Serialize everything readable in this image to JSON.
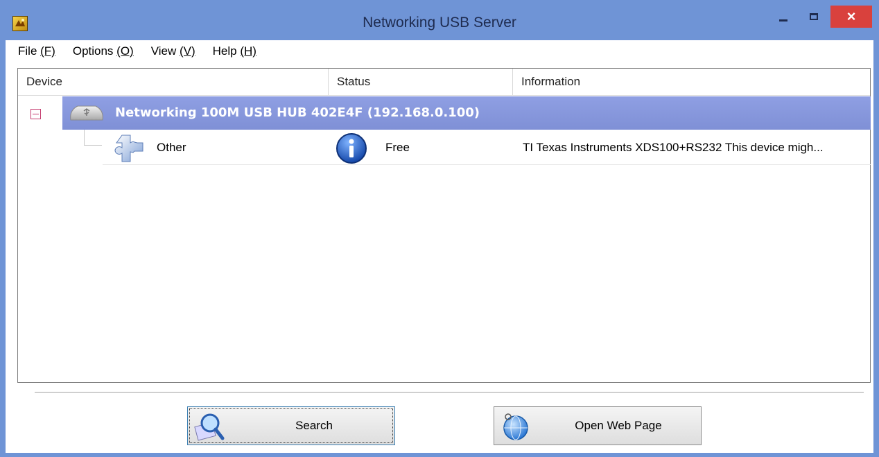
{
  "window": {
    "title": "Networking USB Server",
    "close_glyph": "×"
  },
  "menu": [
    {
      "label": "File ",
      "accel": "(F)"
    },
    {
      "label": "Options ",
      "accel": "(O)"
    },
    {
      "label": "View ",
      "accel": "(V)"
    },
    {
      "label": "Help ",
      "accel": "(H)"
    }
  ],
  "columns": {
    "device": "Device",
    "status": "Status",
    "information": "Information"
  },
  "hub": {
    "label": "Networking 100M USB HUB 402E4F  (192.168.0.100)",
    "icon": "usb-hub-icon",
    "expanded": true
  },
  "devices": [
    {
      "name": "Other",
      "icon": "puzzle-piece-icon",
      "status": "Free",
      "status_icon": "info-icon",
      "information": "TI Texas Instruments XDS100+RS232 This device migh..."
    }
  ],
  "buttons": {
    "search": "Search",
    "open_web_page": "Open Web Page"
  },
  "colors": {
    "titlebar": "#6f94d6",
    "hub_row": "#8797dd",
    "close_button": "#d9413d"
  }
}
